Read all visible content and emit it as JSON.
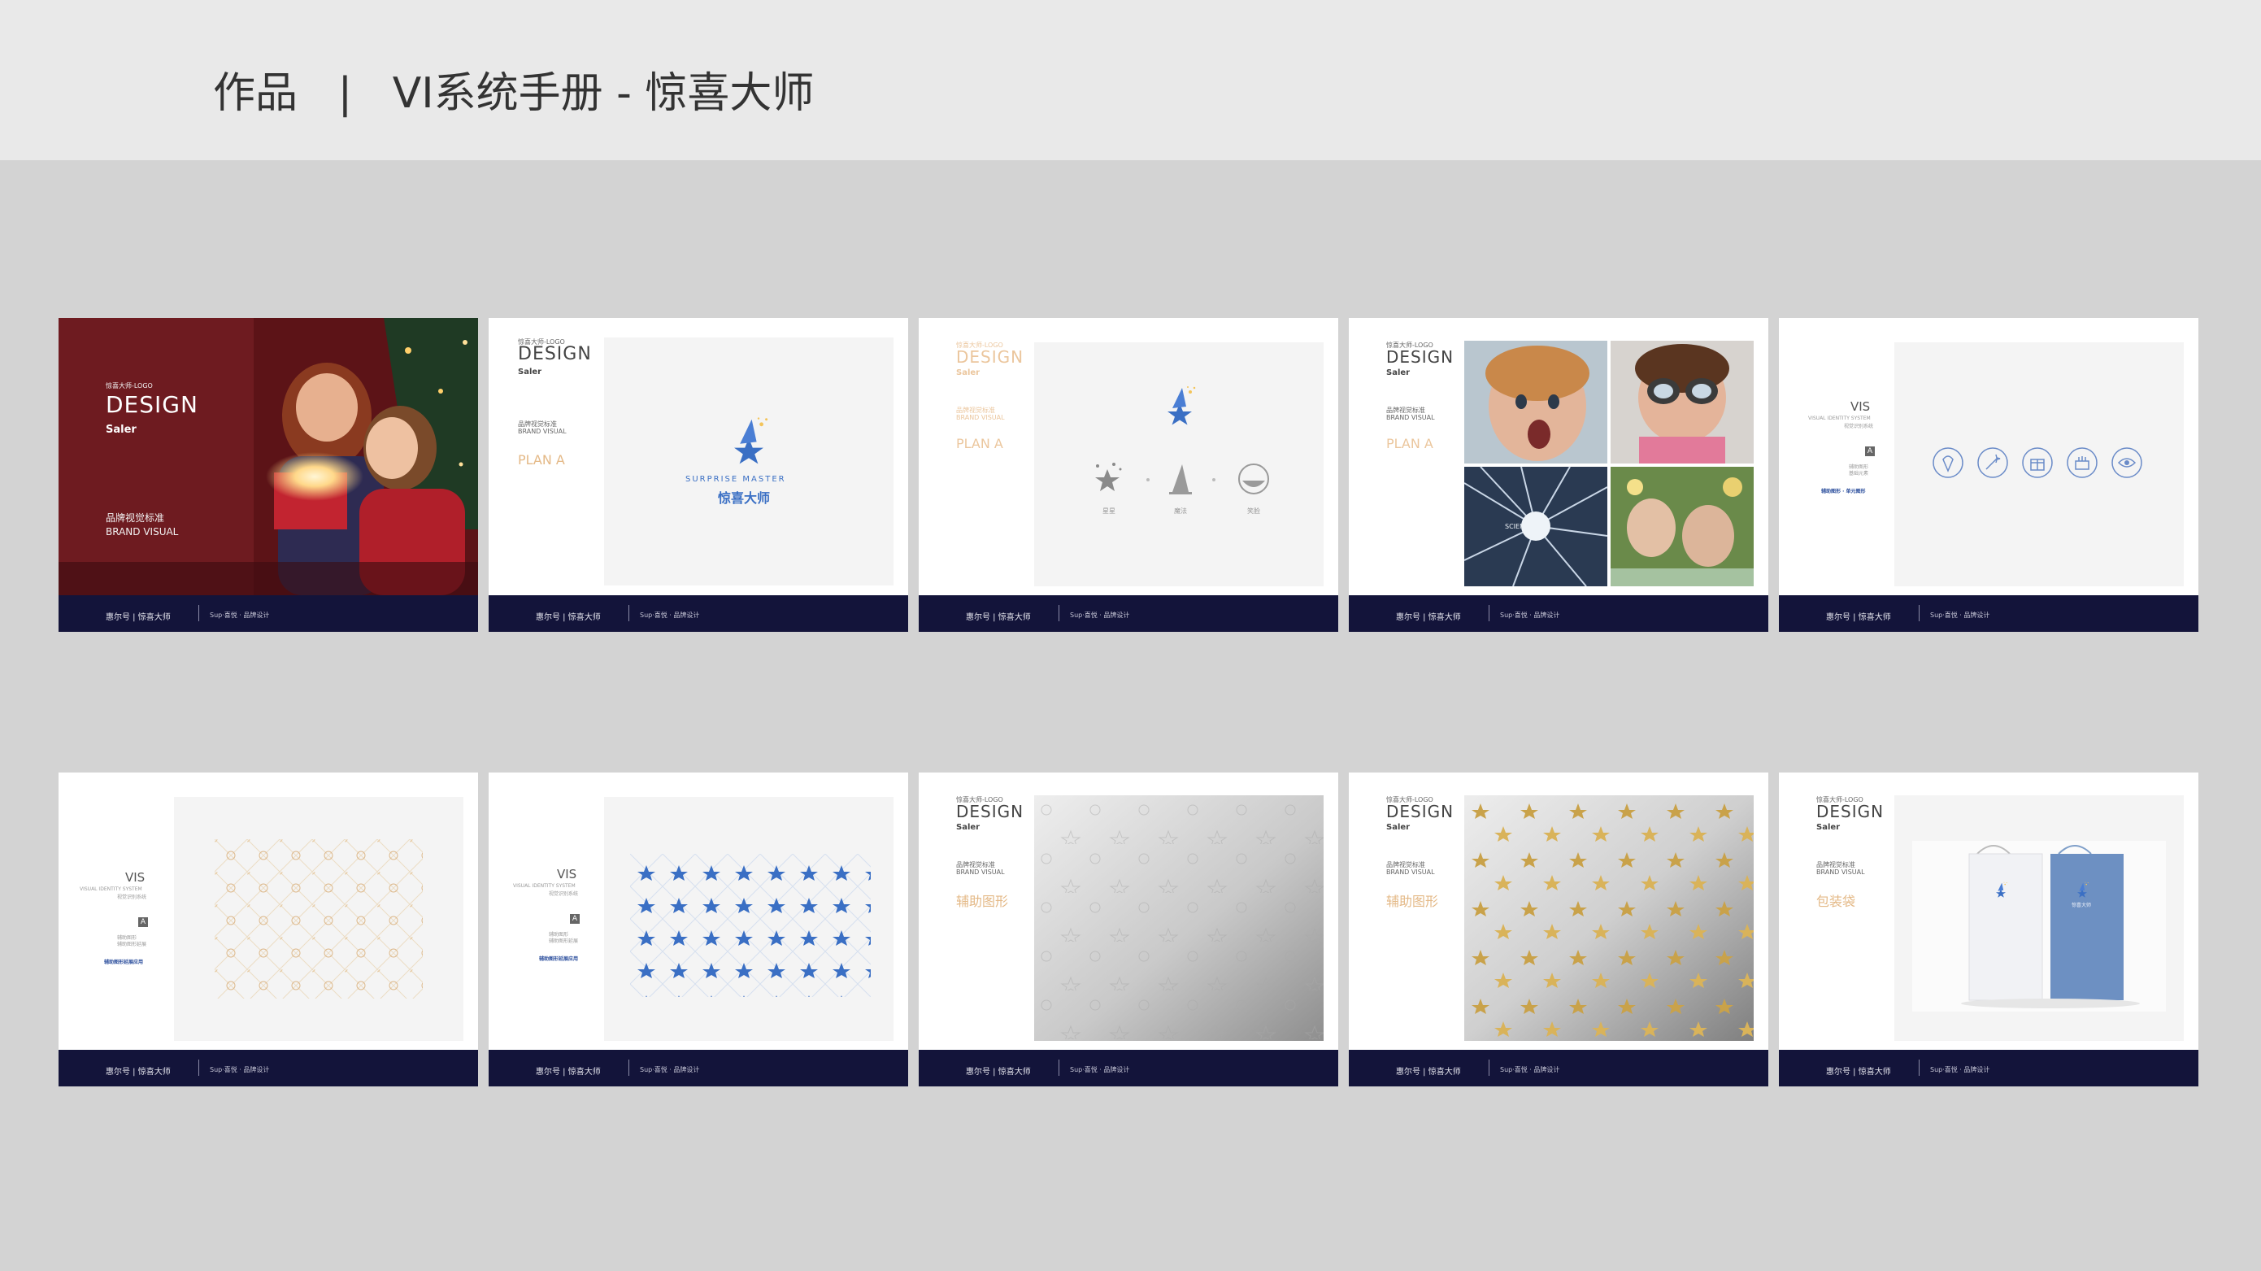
{
  "header": {
    "title": "作品   |   VI系统手册 - 惊喜大师"
  },
  "footer": {
    "left": "惠尔号 | 惊喜大师",
    "right": "Sup·喜悦 · 品牌设计"
  },
  "card1": {
    "sub": "惊喜大师-LOGO",
    "design": "DESIGN",
    "saler": "Saler",
    "brand_cn": "品牌视觉标准",
    "brand_en": "BRAND VISUAL"
  },
  "card2": {
    "sub": "惊喜大师-LOGO",
    "design": "DESIGN",
    "saler": "Saler",
    "brand_cn": "品牌视觉标准",
    "brand_en": "BRAND VISUAL",
    "plan": "PLAN A",
    "logo_en": "SURPRISE MASTER",
    "logo_cn": "惊喜大师"
  },
  "card3": {
    "sub": "惊喜大师-LOGO",
    "design": "DESIGN",
    "saler": "Saler",
    "brand_cn": "品牌视觉标准",
    "brand_en": "BRAND VISUAL",
    "plan": "PLAN A",
    "label1": "星星",
    "label2": "魔法",
    "label3": "笑脸"
  },
  "card4": {
    "sub": "惊喜大师-LOGO",
    "design": "DESIGN",
    "saler": "Saler",
    "brand_cn": "品牌视觉标准",
    "brand_en": "BRAND VISUAL",
    "plan": "PLAN A",
    "photo_text": "SCIENCE FUN"
  },
  "card5": {
    "vis": "VIS",
    "vis_en": "VISUAL IDENTITY SYSTEM",
    "vis_cn": "视觉识别系统",
    "a": "A",
    "sub1": "辅助图形",
    "sub2": "基础元素",
    "blue": "辅助图形 · 单元图形"
  },
  "card6": {
    "vis": "VIS",
    "vis_en": "VISUAL IDENTITY SYSTEM",
    "vis_cn": "视觉识别系统",
    "a": "A",
    "sub1": "辅助图形",
    "sub2": "辅助图形延展",
    "blue": "辅助图形延展应用"
  },
  "card7": {
    "vis": "VIS",
    "vis_en": "VISUAL IDENTITY SYSTEM",
    "vis_cn": "视觉识别系统",
    "a": "A",
    "sub1": "辅助图形",
    "sub2": "辅助图形延展",
    "blue": "辅助图形延展应用"
  },
  "card8": {
    "sub": "惊喜大师-LOGO",
    "design": "DESIGN",
    "saler": "Saler",
    "brand_cn": "品牌视觉标准",
    "brand_en": "BRAND VISUAL",
    "plan": "辅助图形"
  },
  "card9": {
    "sub": "惊喜大师-LOGO",
    "design": "DESIGN",
    "saler": "Saler",
    "brand_cn": "品牌视觉标准",
    "brand_en": "BRAND VISUAL",
    "plan": "辅助图形"
  },
  "card10": {
    "sub": "惊喜大师-LOGO",
    "design": "DESIGN",
    "saler": "Saler",
    "brand_cn": "品牌视觉标准",
    "brand_en": "BRAND VISUAL",
    "plan": "包装袋",
    "bag_text": "惊喜大师"
  },
  "colors": {
    "header_bg": "#e9e9e9",
    "page_bg": "#d3d3d3",
    "footer_navy": "#13143a",
    "accent_orange": "#e4b987",
    "logo_blue": "#3a6fc4"
  }
}
